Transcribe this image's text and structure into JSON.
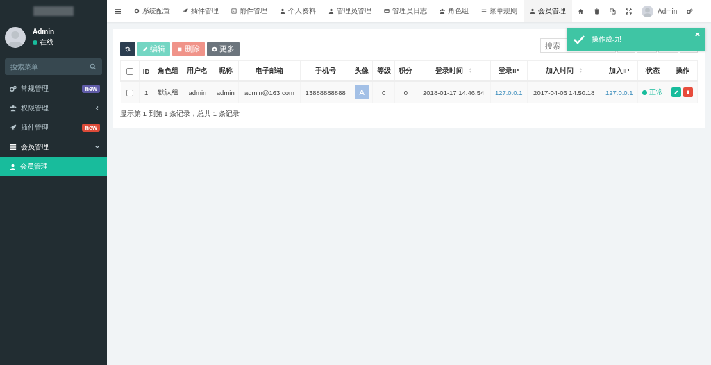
{
  "sidebar": {
    "user": {
      "name": "Admin",
      "status": "在线"
    },
    "search": {
      "placeholder": "搜索菜单"
    },
    "items": [
      {
        "kind": "badge",
        "label": "常规管理",
        "badge": {
          "text": "new",
          "color": "#605ca8"
        }
      },
      {
        "kind": "folder",
        "label": "权限管理",
        "expanded": false
      },
      {
        "kind": "badge",
        "label": "插件管理",
        "badge": {
          "text": "new",
          "color": "#dd4b39"
        }
      },
      {
        "kind": "folder",
        "label": "会员管理",
        "expanded": true,
        "children": [
          {
            "label": "会员管理",
            "selected": true
          }
        ]
      }
    ]
  },
  "tabs": [
    {
      "label": "系统配置",
      "selected": false
    },
    {
      "label": "插件管理",
      "selected": false
    },
    {
      "label": "附件管理",
      "selected": false
    },
    {
      "label": "个人资料",
      "selected": false
    },
    {
      "label": "管理员管理",
      "selected": false
    },
    {
      "label": "管理员日志",
      "selected": false
    },
    {
      "label": "角色组",
      "selected": false
    },
    {
      "label": "菜单规则",
      "selected": false
    },
    {
      "label": "会员管理",
      "selected": true
    }
  ],
  "user_menu": {
    "name": "Admin"
  },
  "toolbar": {
    "buttons": [
      {
        "kind": "refresh",
        "disabled": false
      },
      {
        "kind": "edit",
        "label": "编辑",
        "disabled": true
      },
      {
        "kind": "delete",
        "label": "删除",
        "disabled": true
      },
      {
        "kind": "more",
        "label": "更多",
        "disabled": false
      }
    ],
    "search": {
      "placeholder": "搜索"
    }
  },
  "table": {
    "header_checked": false,
    "columns": [
      {
        "label": "ID",
        "sortable": false
      },
      {
        "label": "角色组",
        "sortable": false
      },
      {
        "label": "用户名",
        "sortable": false
      },
      {
        "label": "昵称",
        "sortable": false
      },
      {
        "label": "电子邮箱",
        "sortable": false
      },
      {
        "label": "手机号",
        "sortable": false
      },
      {
        "label": "头像",
        "sortable": false
      },
      {
        "label": "等级",
        "sortable": false
      },
      {
        "label": "积分",
        "sortable": false
      },
      {
        "label": "登录时间",
        "sortable": true
      },
      {
        "label": "登录IP",
        "sortable": false
      },
      {
        "label": "加入时间",
        "sortable": true
      },
      {
        "label": "加入IP",
        "sortable": false
      },
      {
        "label": "状态",
        "sortable": false
      },
      {
        "label": "操作",
        "sortable": false
      }
    ],
    "rows": [
      {
        "checked": false,
        "cells": [
          {
            "kind": "text",
            "text": "1"
          },
          {
            "kind": "text",
            "text": "默认组"
          },
          {
            "kind": "text",
            "text": "admin"
          },
          {
            "kind": "text",
            "text": "admin"
          },
          {
            "kind": "text",
            "text": "admin@163.com"
          },
          {
            "kind": "text",
            "text": "13888888888"
          },
          {
            "kind": "avatar",
            "text": "A"
          },
          {
            "kind": "text",
            "text": "0"
          },
          {
            "kind": "text",
            "text": "0"
          },
          {
            "kind": "text",
            "text": "2018-01-17 14:46:54"
          },
          {
            "kind": "link",
            "text": "127.0.0.1"
          },
          {
            "kind": "text",
            "text": "2017-04-06 14:50:18"
          },
          {
            "kind": "link",
            "text": "127.0.0.1"
          },
          {
            "kind": "status",
            "text": "正常"
          },
          {
            "kind": "actions"
          }
        ]
      }
    ],
    "footer": "显示第 1 到第 1 条记录，总共 1 条记录"
  },
  "toast": {
    "message": "操作成功!"
  }
}
